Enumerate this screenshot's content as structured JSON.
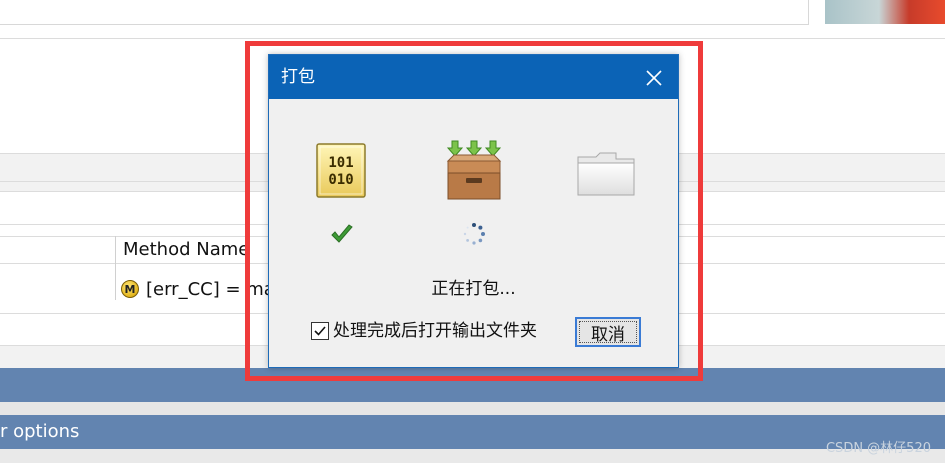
{
  "background": {
    "table_header_label": "Method Name",
    "table_row_text": "[err_CC] = mai",
    "method_icon_letter": "M",
    "section_label": "r options",
    "watermark": "CSDN @林仔520"
  },
  "dialog": {
    "title": "打包",
    "status": "正在打包...",
    "open_folder_checkbox": {
      "label": "处理完成后打开输出文件夹",
      "checked": true
    },
    "cancel_label": "取消",
    "steps": [
      {
        "icon": "binary-file-icon",
        "state": "done",
        "digits_top": "101",
        "digits_bottom": "010"
      },
      {
        "icon": "archive-box-icon",
        "state": "in-progress"
      },
      {
        "icon": "folder-icon",
        "state": "pending"
      }
    ]
  },
  "colors": {
    "title_bar": "#0b63b6",
    "highlight_border": "#ef3b3b",
    "section_bar": "#6284b0",
    "check_green": "#3d9b35"
  }
}
